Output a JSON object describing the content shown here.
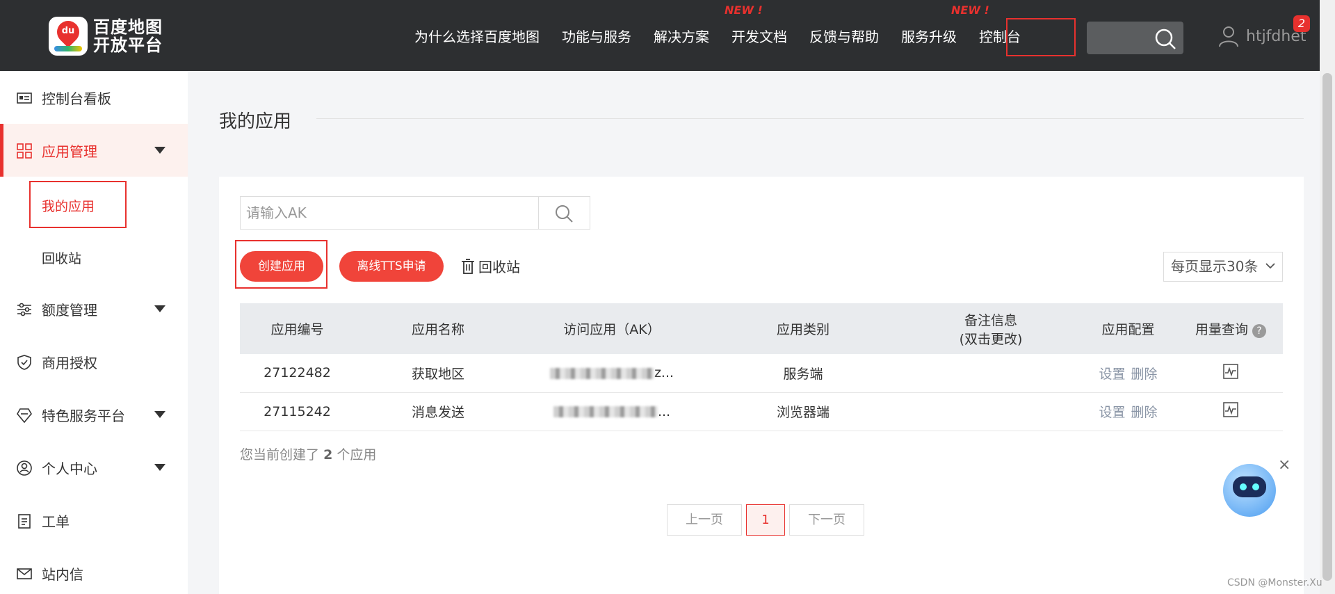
{
  "logo": {
    "badge_text": "du",
    "line1": "百度地图",
    "line2": "开放平台"
  },
  "nav": {
    "items": [
      "为什么选择百度地图",
      "功能与服务",
      "解决方案",
      "开发文档",
      "反馈与帮助",
      "服务升级",
      "控制台"
    ],
    "new_label": "NEW !"
  },
  "user": {
    "name": "htjfdhet",
    "badge": "2"
  },
  "sidebar": {
    "items": [
      "控制台看板",
      "应用管理",
      "额度管理",
      "商用授权",
      "特色服务平台",
      "个人中心",
      "工单",
      "站内信"
    ],
    "sub": [
      "我的应用",
      "回收站"
    ]
  },
  "page": {
    "title": "我的应用"
  },
  "search": {
    "placeholder": "请输入AK"
  },
  "toolbar": {
    "create": "创建应用",
    "tts": "离线TTS申请",
    "recycle": "回收站",
    "per_page": "每页显示30条"
  },
  "table": {
    "headers": [
      "应用编号",
      "应用名称",
      "访问应用（AK）",
      "应用类别",
      "备注信息",
      "(双击更改)",
      "应用配置",
      "用量查询",
      "?"
    ],
    "rows": [
      {
        "id": "27122482",
        "name": "获取地区",
        "ak_tail": "z...",
        "type": "服务端",
        "set": "设置",
        "del": "删除"
      },
      {
        "id": "27115242",
        "name": "消息发送",
        "ak_tail": "...",
        "type": "浏览器端",
        "set": "设置",
        "del": "删除"
      }
    ]
  },
  "summary": {
    "prefix": "您当前创建了",
    "count": "2",
    "suffix": "个应用"
  },
  "pager": {
    "prev": "上一页",
    "current": "1",
    "next": "下一页"
  },
  "widget": {
    "close": "×"
  },
  "watermark": "CSDN @Monster.Xu",
  "colors": {
    "accent": "#e8312e",
    "topbar": "#2d2f31"
  }
}
